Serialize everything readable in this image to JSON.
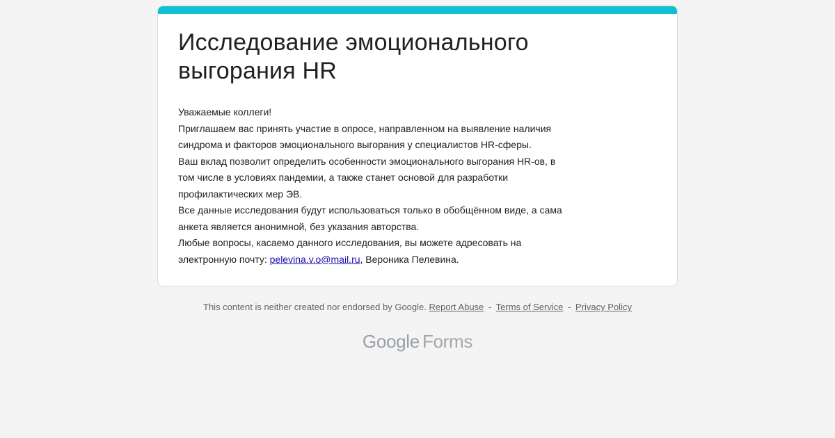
{
  "form": {
    "accent_color": "#12bfd0",
    "title_line1": "Исследование эмоционального",
    "title_line2": "выгорания HR",
    "description": {
      "line1": "Уважаемые коллеги!",
      "line2": "Приглашаем вас принять участие в опросе, направленном на выявление наличия",
      "line3": "синдрома и факторов эмоционального выгорания у специалистов HR-сферы.",
      "line4": "Ваш вклад позволит определить особенности эмоционального выгорания HR-ов, в",
      "line5": "том числе в условиях пандемии, а также станет основой для разработки",
      "line6": "профилактических мер ЭВ.",
      "line7": "Все данные исследования будут использоваться только в обобщённом виде, а сама",
      "line8": "анкета является анонимной, без указания авторства.",
      "line9": "Любые вопросы, касаемо данного исследования, вы можете адресовать на",
      "line10_prefix": "электронную почту: ",
      "email_link": "pelevina.v.o@mail.ru",
      "line10_suffix": ", Вероника Пелевина."
    }
  },
  "footer": {
    "disclaimer": "This content is neither created nor endorsed by Google.",
    "report_abuse": "Report Abuse",
    "terms_of_service": "Terms of Service",
    "privacy_policy": "Privacy Policy",
    "separator": "-"
  },
  "logo": {
    "google": "Google",
    "forms": "Forms"
  }
}
